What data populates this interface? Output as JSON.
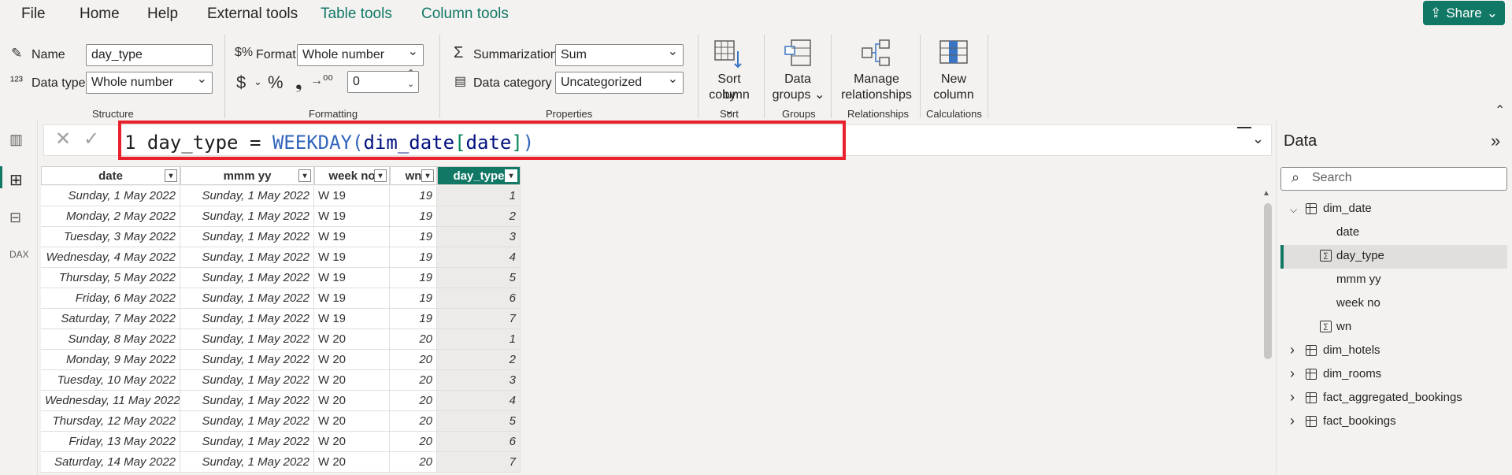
{
  "menu": {
    "items": [
      "File",
      "Home",
      "Help",
      "External tools",
      "Table tools",
      "Column tools"
    ],
    "share": "Share"
  },
  "ribbon": {
    "structure": {
      "name_label": "Name",
      "name_value": "day_type",
      "datatype_label": "Data type",
      "datatype_value": "Whole number",
      "group": "Structure"
    },
    "formatting": {
      "format_label": "Format",
      "format_value": "Whole number",
      "decimals_value": "0",
      "group": "Formatting"
    },
    "properties": {
      "summarization_label": "Summarization",
      "summarization_value": "Sum",
      "category_label": "Data category",
      "category_value": "Uncategorized",
      "group": "Properties"
    },
    "sort": {
      "line1": "Sort by",
      "line2": "column",
      "group": "Sort"
    },
    "groups": {
      "line1": "Data",
      "line2": "groups",
      "group": "Groups"
    },
    "relationships": {
      "line1": "Manage",
      "line2": "relationships",
      "group": "Relationships"
    },
    "calculations": {
      "line1": "New",
      "line2": "column",
      "group": "Calculations"
    }
  },
  "formula": {
    "line_no": "1",
    "name": "day_type",
    "op": "=",
    "fn": "WEEKDAY",
    "table": "dim_date",
    "column": "date"
  },
  "table": {
    "columns": [
      "date",
      "mmm yy",
      "week no",
      "wn",
      "day_type"
    ],
    "rows": [
      [
        "Sunday, 1 May 2022",
        "Sunday, 1 May 2022",
        "W 19",
        "19",
        "1"
      ],
      [
        "Monday, 2 May 2022",
        "Sunday, 1 May 2022",
        "W 19",
        "19",
        "2"
      ],
      [
        "Tuesday, 3 May 2022",
        "Sunday, 1 May 2022",
        "W 19",
        "19",
        "3"
      ],
      [
        "Wednesday, 4 May 2022",
        "Sunday, 1 May 2022",
        "W 19",
        "19",
        "4"
      ],
      [
        "Thursday, 5 May 2022",
        "Sunday, 1 May 2022",
        "W 19",
        "19",
        "5"
      ],
      [
        "Friday, 6 May 2022",
        "Sunday, 1 May 2022",
        "W 19",
        "19",
        "6"
      ],
      [
        "Saturday, 7 May 2022",
        "Sunday, 1 May 2022",
        "W 19",
        "19",
        "7"
      ],
      [
        "Sunday, 8 May 2022",
        "Sunday, 1 May 2022",
        "W 20",
        "20",
        "1"
      ],
      [
        "Monday, 9 May 2022",
        "Sunday, 1 May 2022",
        "W 20",
        "20",
        "2"
      ],
      [
        "Tuesday, 10 May 2022",
        "Sunday, 1 May 2022",
        "W 20",
        "20",
        "3"
      ],
      [
        "Wednesday, 11 May 2022",
        "Sunday, 1 May 2022",
        "W 20",
        "20",
        "4"
      ],
      [
        "Thursday, 12 May 2022",
        "Sunday, 1 May 2022",
        "W 20",
        "20",
        "5"
      ],
      [
        "Friday, 13 May 2022",
        "Sunday, 1 May 2022",
        "W 20",
        "20",
        "6"
      ],
      [
        "Saturday, 14 May 2022",
        "Sunday, 1 May 2022",
        "W 20",
        "20",
        "7"
      ]
    ]
  },
  "data_pane": {
    "title": "Data",
    "search_placeholder": "Search",
    "tree": [
      {
        "label": "dim_date",
        "type": "table",
        "expanded": true
      },
      {
        "label": "date",
        "type": "field"
      },
      {
        "label": "day_type",
        "type": "calc",
        "selected": true
      },
      {
        "label": "mmm yy",
        "type": "field"
      },
      {
        "label": "week no",
        "type": "field"
      },
      {
        "label": "wn",
        "type": "calc"
      },
      {
        "label": "dim_hotels",
        "type": "table"
      },
      {
        "label": "dim_rooms",
        "type": "table"
      },
      {
        "label": "fact_aggregated_bookings",
        "type": "table"
      },
      {
        "label": "fact_bookings",
        "type": "table"
      }
    ]
  },
  "colors": {
    "accent": "#117865",
    "highlight": "#e8212d"
  }
}
